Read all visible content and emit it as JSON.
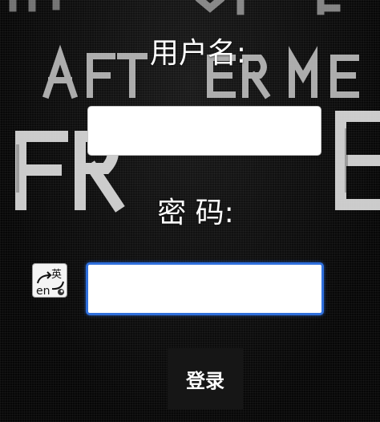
{
  "form": {
    "username_label": "用户名:",
    "username_value": "",
    "password_label": "密 码:",
    "password_value": "",
    "submit_label": "登录"
  },
  "ime_indicator": {
    "icon": "ime-switch-icon",
    "top_text": "英",
    "bottom_text": "en"
  },
  "background": {
    "words": [
      "AFTER",
      "FREE"
    ]
  },
  "colors": {
    "background": "#0b0b0b",
    "label_text": "#ffffff",
    "focus_border": "#2f6fdc",
    "button_bg": "#161616"
  }
}
